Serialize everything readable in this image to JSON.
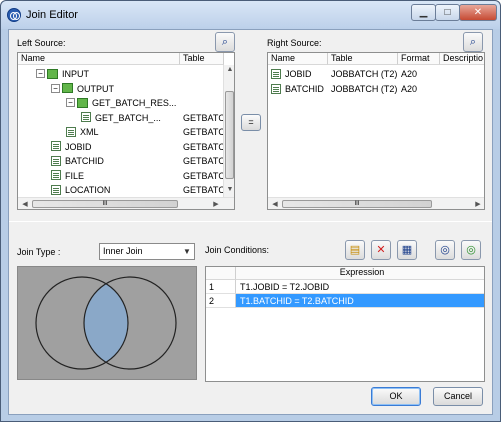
{
  "window": {
    "title": "Join Editor"
  },
  "left_source": {
    "label": "Left Source:",
    "columns": [
      "Name",
      "Table"
    ],
    "rows": [
      {
        "name": "INPUT",
        "table": "",
        "icon": "cube-icon",
        "expander": "−",
        "indent": 0
      },
      {
        "name": "OUTPUT",
        "table": "",
        "icon": "cube-icon",
        "expander": "−",
        "indent": 1
      },
      {
        "name": "GET_BATCH_RES...",
        "table": "",
        "icon": "cube-icon",
        "expander": "−",
        "indent": 2
      },
      {
        "name": "GET_BATCH_...",
        "table": "GETBATC",
        "icon": "table-icon",
        "expander": "",
        "indent": 3
      },
      {
        "name": "XML",
        "table": "GETBATC",
        "icon": "table-icon",
        "expander": "",
        "indent": 2
      },
      {
        "name": "JOBID",
        "table": "GETBATC",
        "icon": "table-icon",
        "expander": "",
        "indent": 1
      },
      {
        "name": "BATCHID",
        "table": "GETBATC",
        "icon": "table-icon",
        "expander": "",
        "indent": 1
      },
      {
        "name": "FILE",
        "table": "GETBATC",
        "icon": "table-icon",
        "expander": "",
        "indent": 1
      },
      {
        "name": "LOCATION",
        "table": "GETBATC",
        "icon": "table-icon",
        "expander": "",
        "indent": 1
      }
    ],
    "hscroll_glyph": "III"
  },
  "right_source": {
    "label": "Right Source:",
    "columns": [
      "Name",
      "Table",
      "Format",
      "Descriptio"
    ],
    "rows": [
      {
        "name": "JOBID",
        "table": "JOBBATCH (T2)",
        "format": "A20",
        "description": ""
      },
      {
        "name": "BATCHID",
        "table": "JOBBATCH (T2)",
        "format": "A20",
        "description": ""
      }
    ],
    "hscroll_glyph": "III"
  },
  "equals_button": "=",
  "join_type": {
    "label": "Join Type :",
    "value": "Inner Join"
  },
  "join_conditions": {
    "label": "Join Conditions:",
    "column": "Expression",
    "rows": [
      {
        "num": "1",
        "expression": "T1.JOBID = T2.JOBID",
        "selected": false
      },
      {
        "num": "2",
        "expression": "T1.BATCHID = T2.BATCHID",
        "selected": true
      }
    ]
  },
  "buttons": {
    "ok": "OK",
    "cancel": "Cancel"
  },
  "colors": {
    "selection": "#3399ff",
    "venn_fill": "#8aa8c8",
    "venn_bg": "#a0a0a0"
  }
}
